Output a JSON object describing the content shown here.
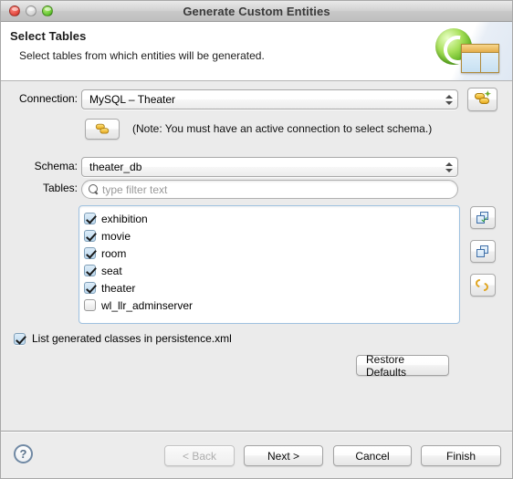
{
  "window": {
    "title": "Generate Custom Entities",
    "traffic_lights": [
      "close-button",
      "minimize-button",
      "zoom-button"
    ]
  },
  "banner": {
    "heading": "Select Tables",
    "description": "Select tables from which entities will be generated.",
    "icon": "entity-table-icon"
  },
  "form": {
    "connection_label": "Connection:",
    "connection_value": "MySQL – Theater",
    "new_connection_button_icon": "new-connection-icon",
    "connect_button_icon": "connect-icon",
    "note": "(Note: You must have an active connection to select schema.)",
    "schema_label": "Schema:",
    "schema_value": "theater_db",
    "tables_label": "Tables:",
    "filter_placeholder": "type filter text",
    "filter_value": ""
  },
  "tables": {
    "items": [
      {
        "name": "exhibition",
        "checked": true
      },
      {
        "name": "movie",
        "checked": true
      },
      {
        "name": "room",
        "checked": true
      },
      {
        "name": "seat",
        "checked": true
      },
      {
        "name": "theater",
        "checked": true
      },
      {
        "name": "wl_llr_adminserver",
        "checked": false
      }
    ],
    "side_buttons": [
      {
        "name": "select-all-button",
        "icon": "select-all-icon"
      },
      {
        "name": "deselect-all-button",
        "icon": "deselect-all-icon"
      },
      {
        "name": "refresh-button",
        "icon": "refresh-icon"
      }
    ]
  },
  "options": {
    "list_generated_label": "List generated classes in persistence.xml",
    "list_generated_checked": true,
    "restore_defaults_label": "Restore Defaults"
  },
  "footer": {
    "help_label": "?",
    "back_label": "< Back",
    "back_disabled": true,
    "next_label": "Next >",
    "cancel_label": "Cancel",
    "finish_label": "Finish"
  },
  "colors": {
    "dialog_bg": "#ebebeb",
    "banner_bg": "#ffffff",
    "list_border": "#9ec1e0",
    "accent_green": "#63b524",
    "accent_gold": "#e8a91c"
  }
}
